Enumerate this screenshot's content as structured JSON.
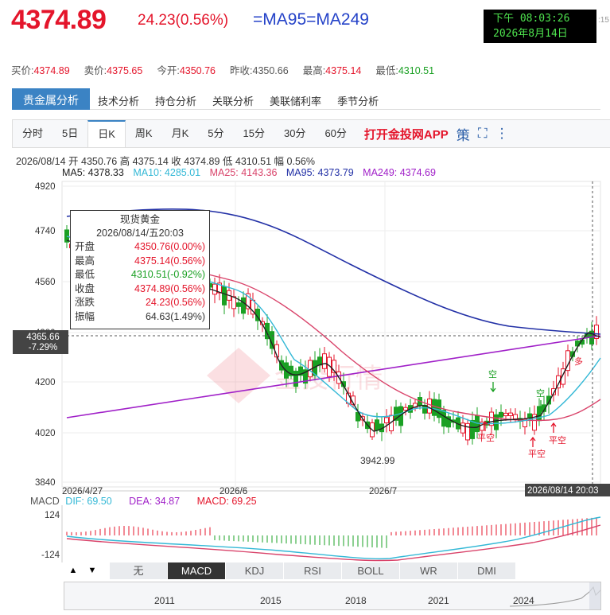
{
  "header": {
    "price": "4374.89",
    "change": "24.23(0.56%)",
    "ma_label": "=MA95=MA249",
    "clock_line1": "下午 08:03:26",
    "clock_line2": "2026年8月14日",
    "clock_extra": ":15"
  },
  "quote": {
    "buy_label": "买价:",
    "buy": "4374.89",
    "sell_label": "卖价:",
    "sell": "4375.65",
    "open_label": "今开:",
    "open": "4350.76",
    "prev_label": "昨收:",
    "prev": "4350.66",
    "high_label": "最高:",
    "high": "4375.14",
    "low_label": "最低:",
    "low": "4310.51"
  },
  "tabs": {
    "main": "贵金属分析",
    "items": [
      "技术分析",
      "持仓分析",
      "关联分析",
      "美联储利率",
      "季节分析"
    ]
  },
  "periods": {
    "items": [
      "分时",
      "5日",
      "日K",
      "周K",
      "月K",
      "5分",
      "15分",
      "30分",
      "60分"
    ],
    "active_index": 2,
    "app_link": "打开金投网APP",
    "icon_logo": "策",
    "icon_fullscreen": "⛶",
    "icon_more": "⋮"
  },
  "ohlc_line": "2026/08/14 开 4350.76 高 4375.14 收 4374.89 低 4310.51 幅 0.56%",
  "ma_values": {
    "ma5": "MA5: 4378.33",
    "ma10": "MA10: 4285.01",
    "ma25": "MA25: 4143.36",
    "ma95": "MA95: 4373.79",
    "ma249": "MA249: 4374.69"
  },
  "colors": {
    "red": "#e4152b",
    "green": "#1aa023",
    "ma5": "#222222",
    "ma10": "#33b8d6",
    "ma25": "#d9436a",
    "ma95": "#2230a6",
    "ma249": "#a020c8",
    "accent": "#3b83c4"
  },
  "axis": {
    "y_ticks": [
      "4920",
      "4740",
      "4560",
      "4380",
      "4200",
      "4020",
      "3840"
    ],
    "x_ticks": [
      "2026/4/27",
      "2026/6",
      "2026/7"
    ],
    "crosshair_price": "4365.66",
    "crosshair_pct": "-7.29%",
    "crosshair_date": "2026/08/14 20:03",
    "low_marker": "3942.99"
  },
  "markers": [
    "空",
    "空",
    "多",
    "平空",
    "平空",
    "平空"
  ],
  "tooltip": {
    "title": "现货黄金",
    "date": "2026/08/14/五20:03",
    "rows": [
      {
        "label": "开盘",
        "value": "4350.76(0.00%)",
        "color": "#e4152b"
      },
      {
        "label": "最高",
        "value": "4375.14(0.56%)",
        "color": "#e4152b"
      },
      {
        "label": "最低",
        "value": "4310.51(-0.92%)",
        "color": "#1aa023"
      },
      {
        "label": "收盘",
        "value": "4374.89(0.56%)",
        "color": "#e4152b"
      },
      {
        "label": "涨跌",
        "value": "24.23(0.56%)",
        "color": "#e4152b"
      },
      {
        "label": "振幅",
        "value": "64.63(1.49%)",
        "color": "#333333"
      }
    ]
  },
  "macd": {
    "label": "MACD",
    "dif": "DIF: 69.50",
    "dea": "DEA: 34.87",
    "macd": "MACD: 69.25",
    "y_ticks": [
      "124",
      "-124"
    ]
  },
  "indicators": {
    "up": "▲",
    "down": "▼",
    "items": [
      "无",
      "MACD",
      "KDJ",
      "RSI",
      "BOLL",
      "WR",
      "DMI"
    ],
    "active_index": 1
  },
  "timeline_years": [
    "2011",
    "2015",
    "2018",
    "2021",
    "2024"
  ],
  "watermark": "金投行情"
}
